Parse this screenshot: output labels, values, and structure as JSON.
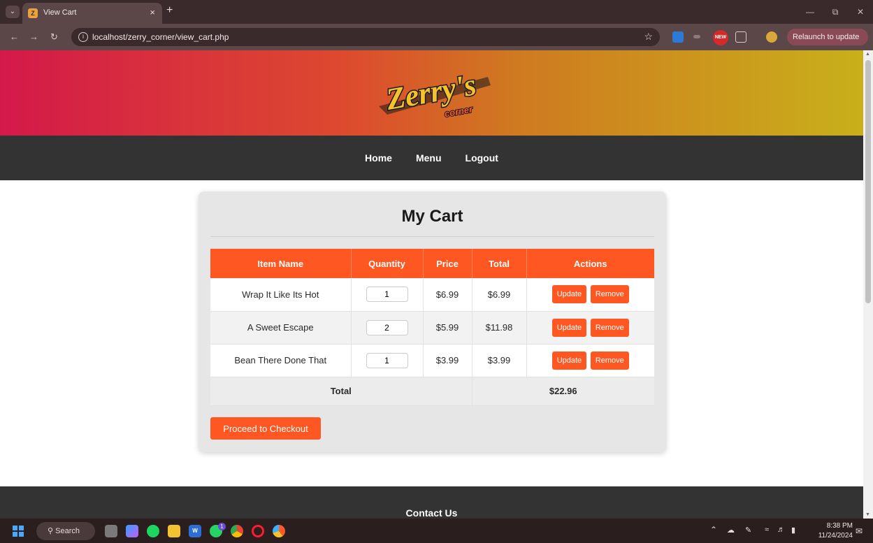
{
  "browser": {
    "tab_title": "View Cart",
    "tab_favicon": "zc-favicon",
    "url": "localhost/zerry_corner/view_cart.php",
    "relaunch_label": "Relaunch to update",
    "new_badge": "NEW"
  },
  "site": {
    "logo_main": "Zerry's",
    "logo_sub": "corner",
    "nav": [
      "Home",
      "Menu",
      "Logout"
    ]
  },
  "cart": {
    "title": "My Cart",
    "columns": [
      "Item Name",
      "Quantity",
      "Price",
      "Total",
      "Actions"
    ],
    "rows": [
      {
        "name": "Wrap It Like Its Hot",
        "qty": "1",
        "price": "$6.99",
        "total": "$6.99"
      },
      {
        "name": "A Sweet Escape",
        "qty": "2",
        "price": "$5.99",
        "total": "$11.98"
      },
      {
        "name": "Bean There Done That",
        "qty": "1",
        "price": "$3.99",
        "total": "$3.99"
      }
    ],
    "update_label": "Update",
    "remove_label": "Remove",
    "total_label": "Total",
    "grand_total": "$22.96",
    "checkout_label": "Proceed to Checkout"
  },
  "footer": {
    "title": "Contact Us"
  },
  "taskbar": {
    "search_label": "Search",
    "time": "8:38 PM",
    "date": "11/24/2024",
    "whatsapp_badge": "1"
  },
  "colors": {
    "accent": "#ff5722",
    "nav_bg": "#333333",
    "card_bg": "#e6e6e6"
  }
}
